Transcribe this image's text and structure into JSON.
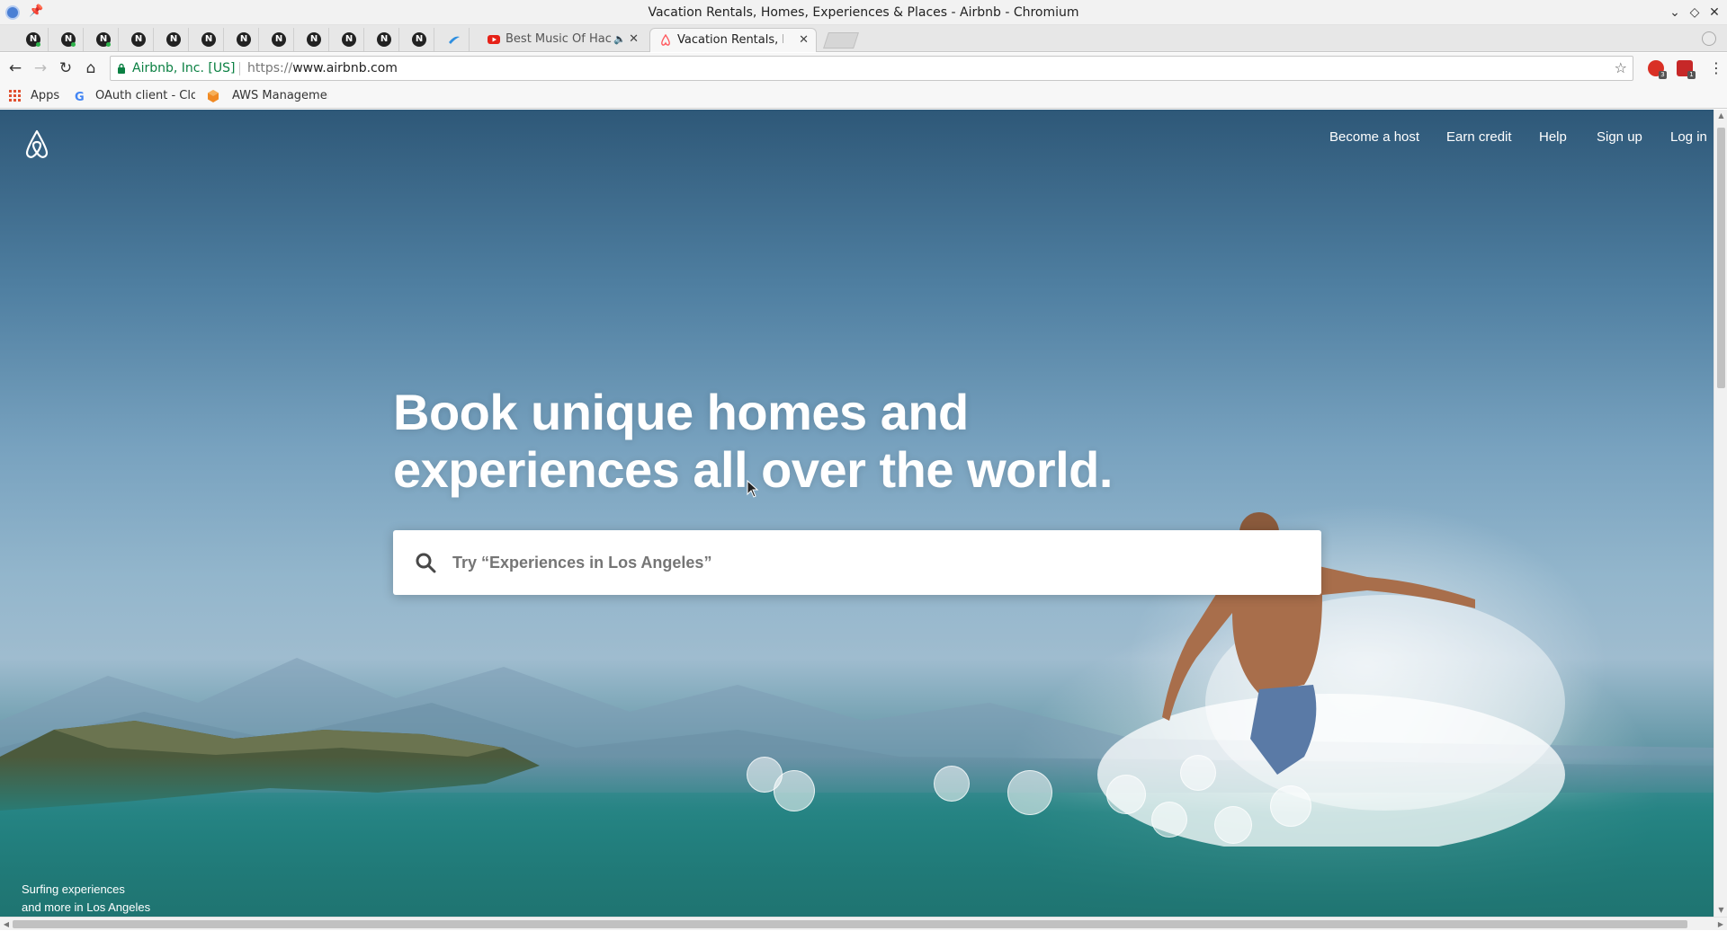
{
  "window": {
    "title": "Vacation Rentals, Homes, Experiences & Places - Airbnb - Chromium"
  },
  "tabs": {
    "pinned_count": 12,
    "youtube_tab_title": "Best Music Of Hack",
    "active_tab_title": "Vacation Rentals, Hom"
  },
  "omnibox": {
    "secure_label": "Airbnb, Inc. [US]",
    "url_scheme": "https://",
    "url_host": "www.airbnb.com"
  },
  "extensions": {
    "ext1_badge": "3",
    "ext2_badge": "1"
  },
  "bookmarks": {
    "apps_label": "Apps",
    "oauth_label": "OAuth client - Clo",
    "aws_label": "AWS Managemen"
  },
  "page": {
    "nav": {
      "become_host": "Become a host",
      "earn_credit": "Earn credit",
      "help": "Help",
      "sign_up": "Sign up",
      "log_in": "Log in"
    },
    "hero": {
      "title_line1": "Book unique homes and",
      "title_line2": "experiences all over the world."
    },
    "search": {
      "placeholder": "Try “Experiences in Los Angeles”",
      "value": ""
    },
    "caption": {
      "line1": "Surfing experiences",
      "line2": "and more in Los Angeles"
    }
  },
  "colors": {
    "brand_accent": "#FF5A5F",
    "secure_green": "#0b8043"
  }
}
